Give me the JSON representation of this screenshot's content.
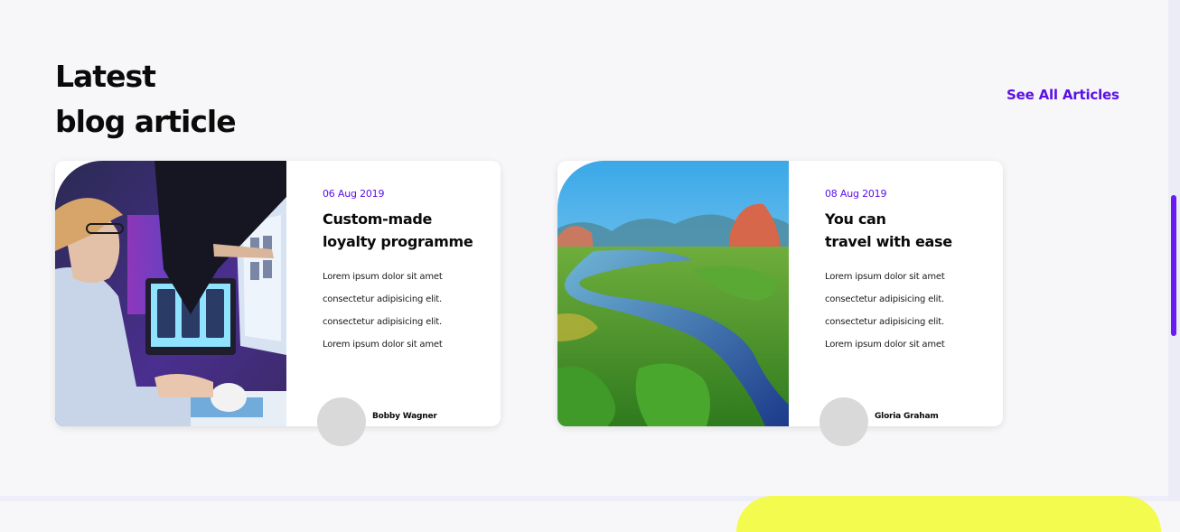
{
  "section": {
    "title_line1": "Latest",
    "title_line2": "blog article",
    "see_all_label": "See All Articles"
  },
  "articles": [
    {
      "date": "06 Aug 2019",
      "title_line1": "Custom-made",
      "title_line2": "loyalty programme",
      "excerpt": [
        "Lorem ipsum dolor sit amet",
        "consectetur adipisicing elit.",
        "consectetur adipisicing elit.",
        "Lorem ipsum dolor sit amet"
      ],
      "author": "Bobby Wagner"
    },
    {
      "date": "08 Aug 2019",
      "title_line1": "You can",
      "title_line2": "travel with ease",
      "excerpt": [
        "Lorem ipsum dolor sit amet",
        "consectetur adipisicing elit.",
        "consectetur adipisicing elit.",
        "Lorem ipsum dolor sit amet"
      ],
      "author": "Gloria Graham"
    }
  ],
  "colors": {
    "accent": "#5b10e8",
    "background": "#f7f7f9",
    "card": "#ffffff",
    "avatar": "#d9d9d9",
    "footer_blob": "#f3fb4e"
  }
}
